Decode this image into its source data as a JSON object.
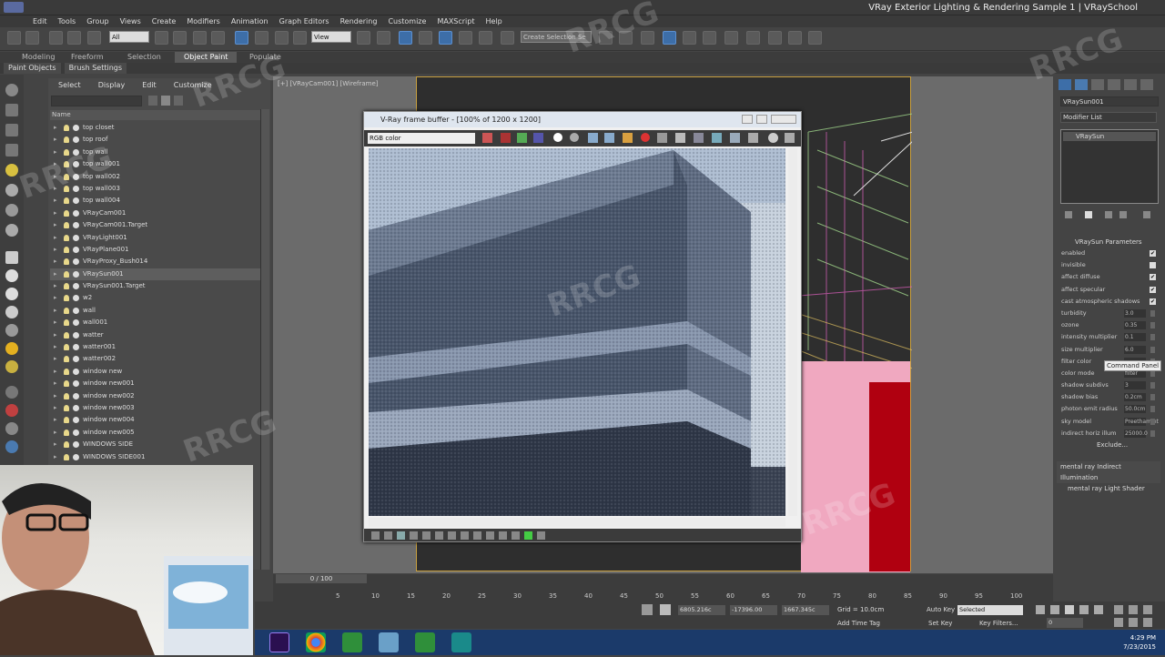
{
  "window": {
    "title": "VRay Exterior Lighting & Rendering Sample 1  |  VRaySchool"
  },
  "menu": [
    "Edit",
    "Tools",
    "Group",
    "Views",
    "Create",
    "Modifiers",
    "Animation",
    "Graph Editors",
    "Rendering",
    "Customize",
    "MAXScript",
    "Help"
  ],
  "toolbar": {
    "filter": "All",
    "view": "View",
    "selection_set": "Create Selection Se"
  },
  "ribbon": {
    "tabs": [
      "Modeling",
      "Freeform",
      "Selection",
      "Object Paint",
      "Populate"
    ],
    "active": "Object Paint",
    "sub": [
      "Paint Objects",
      "Brush Settings"
    ]
  },
  "scene_explorer": {
    "menu": [
      "Select",
      "Display",
      "Edit",
      "Customize"
    ],
    "column": "Name",
    "items": [
      "top closet",
      "top roof",
      "top wall",
      "top wall001",
      "top wall002",
      "top wall003",
      "top wall004",
      "VRayCam001",
      "VRayCam001.Target",
      "VRayLight001",
      "VRayPlane001",
      "VRayProxy_Bush014",
      "VRaySun001",
      "VRaySun001.Target",
      "w2",
      "wall",
      "wall001",
      "watter",
      "watter001",
      "watter002",
      "window new",
      "window new001",
      "window new002",
      "window new003",
      "window new004",
      "window new005",
      "WINDOWS SIDE",
      "WINDOWS SIDE001"
    ],
    "selected": "VRaySun001"
  },
  "viewport": {
    "label": "[+] [VRayCam001] [Wireframe]"
  },
  "vfb": {
    "title": "V-Ray frame buffer - [100% of 1200 x 1200]",
    "channel": "RGB color"
  },
  "command_panel": {
    "object_name": "VRaySun001",
    "modifier_list": "Modifier List",
    "stack": [
      "VRaySun"
    ],
    "rollout": "VRaySun Parameters",
    "params": [
      {
        "label": "enabled",
        "check": "✔"
      },
      {
        "label": "invisible",
        "check": ""
      },
      {
        "label": "affect diffuse",
        "check": "✔"
      },
      {
        "label": "affect specular",
        "check": "✔"
      },
      {
        "label": "cast atmospheric shadows",
        "check": "✔"
      },
      {
        "label": "turbidity",
        "value": "3.0"
      },
      {
        "label": "ozone",
        "value": "0.35"
      },
      {
        "label": "intensity multiplier",
        "value": "0.1"
      },
      {
        "label": "size multiplier",
        "value": "6.0"
      },
      {
        "label": "filter color",
        "value": ""
      },
      {
        "label": "color mode",
        "value": "filter"
      },
      {
        "label": "shadow subdivs",
        "value": "3"
      },
      {
        "label": "shadow bias",
        "value": "0.2cm"
      },
      {
        "label": "photon emit radius",
        "value": "50.0cm"
      },
      {
        "label": "sky model",
        "value": "Preetham et"
      },
      {
        "label": "indirect horiz illum",
        "value": "25000.0"
      }
    ],
    "exclude": "Exclude...",
    "tooltip": "Command Panel",
    "rollouts_bottom": [
      "mental ray Indirect Illumination",
      "mental ray Light Shader"
    ]
  },
  "timeline": {
    "range": "0 / 100",
    "ticks": [
      "5",
      "10",
      "15",
      "20",
      "25",
      "30",
      "35",
      "40",
      "45",
      "50",
      "55",
      "60",
      "65",
      "70",
      "75",
      "80",
      "85",
      "90",
      "95",
      "100"
    ]
  },
  "status": {
    "x": "6805.216c",
    "y": "-17396.00",
    "z": "1667.345c",
    "grid": "Grid = 10.0cm",
    "autokey": "Auto Key",
    "selected": "Selected",
    "setkey": "Set Key",
    "keyfilters": "Key Filters...",
    "frame": "0",
    "add_tag": "Add Time Tag"
  },
  "clock": {
    "time": "4:29 PM",
    "date": "7/23/2015"
  },
  "watermark": "RRCG"
}
